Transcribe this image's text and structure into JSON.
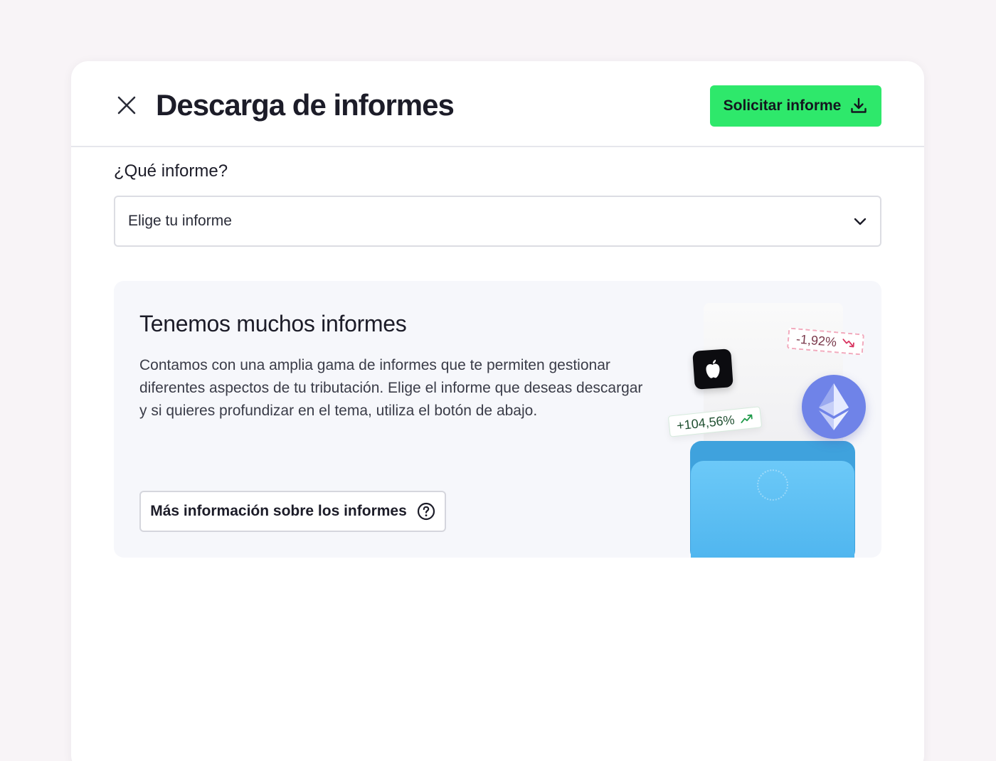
{
  "header": {
    "title": "Descarga de informes",
    "primary_button": "Solicitar informe",
    "close_icon": "close-icon",
    "download_icon": "download-icon"
  },
  "form": {
    "label": "¿Qué informe?",
    "select_value": "Elige tu informe",
    "select_icon": "chevron-down-icon"
  },
  "info_card": {
    "title": "Tenemos muchos informes",
    "body": "Contamos con una amplia gama de informes que te permiten gestionar diferentes aspectos de tu tributación. Elige el informe que deseas descargar y si quieres profundizar en el tema, utiliza el botón de abajo.",
    "button": "Más información sobre los informes",
    "button_icon": "help-circle-icon"
  },
  "illustration": {
    "tag_up": "+104,56%",
    "tag_down": "-1,92%",
    "icons": [
      "apple-icon",
      "ethereum-icon",
      "trend-up-icon",
      "trend-down-icon",
      "wallet-icon"
    ]
  },
  "colors": {
    "accent": "#2ee86b",
    "background": "#f8f4f7",
    "card": "#f6f7fb",
    "positive": "#1f9a4a",
    "negative": "#d8345f",
    "ethereum": "#6f83e8",
    "wallet": "#5bbdf2"
  }
}
